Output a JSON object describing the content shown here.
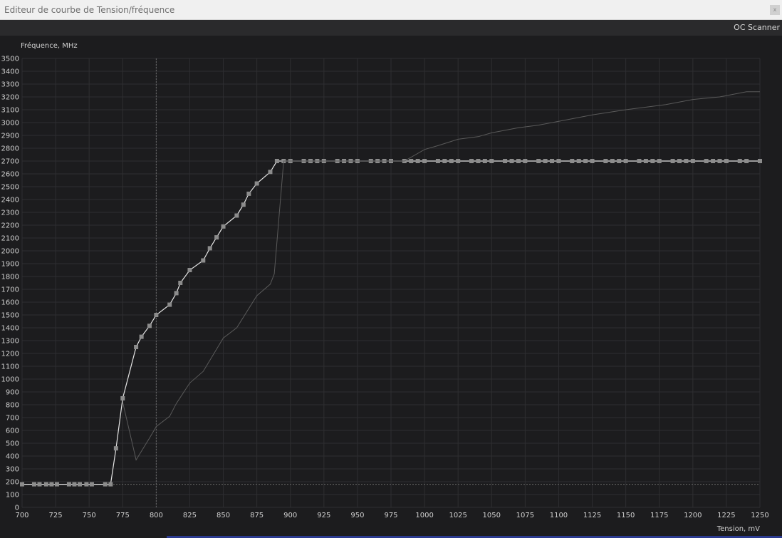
{
  "window": {
    "title": "Editeur de courbe de Tension/fréquence",
    "close_glyph": "x"
  },
  "toolbar": {
    "oc_scanner_label": "OC Scanner"
  },
  "colors": {
    "background": "#1c1c1e",
    "grid": "#2e2e31",
    "axis_text": "#cfcfcf",
    "main_curve": "#e6e6e6",
    "marker": "#8c8c8c",
    "reference_curve": "#5a5a5a",
    "guide": "#6a6a6a"
  },
  "chart_data": {
    "type": "line",
    "ylabel": "Fréquence, MHz",
    "xlabel": "Tension, mV",
    "xlim": [
      700,
      1250
    ],
    "ylim": [
      0,
      3500
    ],
    "x_ticks": [
      700,
      725,
      750,
      775,
      800,
      825,
      850,
      875,
      900,
      925,
      950,
      975,
      1000,
      1025,
      1050,
      1075,
      1100,
      1125,
      1150,
      1175,
      1200,
      1225,
      1250
    ],
    "y_ticks": [
      0,
      100,
      200,
      300,
      400,
      500,
      600,
      700,
      800,
      900,
      1000,
      1100,
      1200,
      1300,
      1400,
      1500,
      1600,
      1700,
      1800,
      1900,
      2000,
      2100,
      2200,
      2300,
      2400,
      2500,
      2600,
      2700,
      2800,
      2900,
      3000,
      3100,
      3200,
      3300,
      3400,
      3500
    ],
    "grid": true,
    "guides": {
      "vertical_x": 800,
      "horizontal_y": 180
    },
    "series": [
      {
        "role": "main",
        "markers": true,
        "x": [
          700,
          709,
          713,
          718,
          722,
          726,
          735,
          739,
          743,
          748,
          752,
          762,
          766,
          770,
          775,
          785,
          789,
          795,
          800,
          810,
          815,
          818,
          825,
          835,
          840,
          845,
          850,
          860,
          865,
          869,
          875,
          885,
          890,
          895,
          900,
          910,
          915,
          920,
          925,
          935,
          940,
          945,
          950,
          960,
          965,
          970,
          975,
          985,
          990,
          995,
          1000,
          1010,
          1015,
          1020,
          1025,
          1035,
          1040,
          1045,
          1050,
          1060,
          1065,
          1070,
          1075,
          1085,
          1090,
          1095,
          1100,
          1110,
          1115,
          1120,
          1125,
          1135,
          1140,
          1145,
          1150,
          1160,
          1165,
          1170,
          1175,
          1185,
          1190,
          1195,
          1200,
          1210,
          1215,
          1220,
          1225,
          1235,
          1240,
          1250
        ],
        "y": [
          180,
          180,
          180,
          180,
          180,
          180,
          180,
          180,
          180,
          180,
          180,
          180,
          180,
          460,
          850,
          1250,
          1330,
          1415,
          1500,
          1580,
          1670,
          1750,
          1850,
          1925,
          2020,
          2105,
          2190,
          2275,
          2360,
          2445,
          2525,
          2615,
          2700,
          2700,
          2700,
          2700,
          2700,
          2700,
          2700,
          2700,
          2700,
          2700,
          2700,
          2700,
          2700,
          2700,
          2700,
          2700,
          2700,
          2700,
          2700,
          2700,
          2700,
          2700,
          2700,
          2700,
          2700,
          2700,
          2700,
          2700,
          2700,
          2700,
          2700,
          2700,
          2700,
          2700,
          2700,
          2700,
          2700,
          2700,
          2700,
          2700,
          2700,
          2700,
          2700,
          2700,
          2700,
          2700,
          2700,
          2700,
          2700,
          2700,
          2700,
          2700,
          2700,
          2700,
          2700,
          2700,
          2700,
          2700
        ]
      },
      {
        "role": "reference",
        "markers": false,
        "x": [
          775,
          785,
          795,
          800,
          810,
          815,
          825,
          835,
          850,
          860,
          875,
          885,
          888,
          895,
          900,
          985,
          1000,
          1010,
          1025,
          1040,
          1050,
          1070,
          1085,
          1100,
          1125,
          1150,
          1165,
          1180,
          1200,
          1210,
          1220,
          1230,
          1240,
          1250
        ],
        "y": [
          820,
          370,
          540,
          630,
          710,
          810,
          970,
          1060,
          1320,
          1400,
          1650,
          1740,
          1820,
          2700,
          2700,
          2700,
          2790,
          2820,
          2870,
          2890,
          2920,
          2960,
          2980,
          3010,
          3060,
          3100,
          3120,
          3140,
          3180,
          3190,
          3200,
          3220,
          3240,
          3240
        ]
      }
    ]
  }
}
